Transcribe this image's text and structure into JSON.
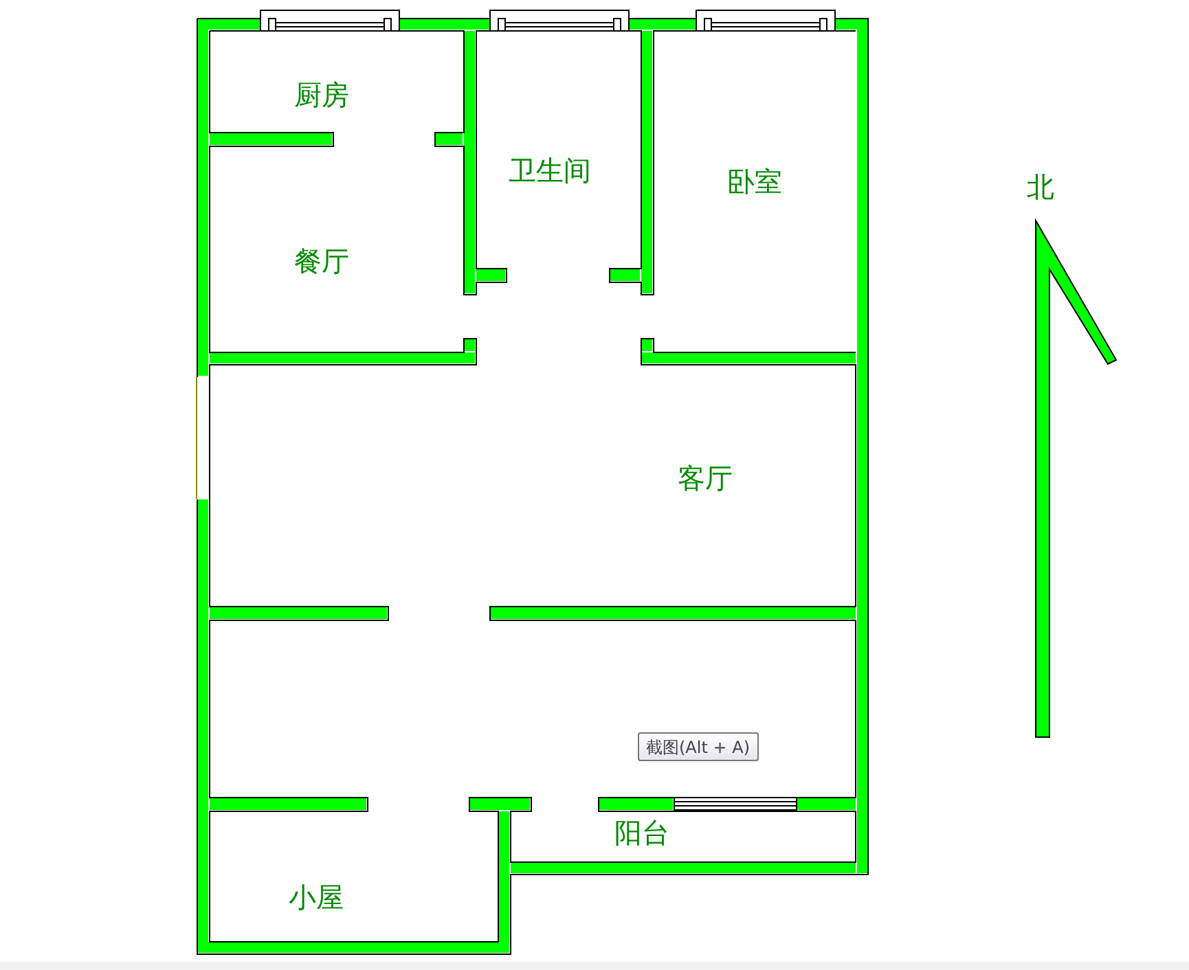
{
  "rooms": [
    {
      "label": "厨房"
    },
    {
      "label": "餐厅"
    },
    {
      "label": "卫生间"
    },
    {
      "label": "卧室"
    },
    {
      "label": "客厅"
    },
    {
      "label": "阳台"
    },
    {
      "label": "小屋"
    }
  ],
  "compass": {
    "label": "北"
  },
  "tooltip": {
    "text": "截图(Alt + A)"
  }
}
